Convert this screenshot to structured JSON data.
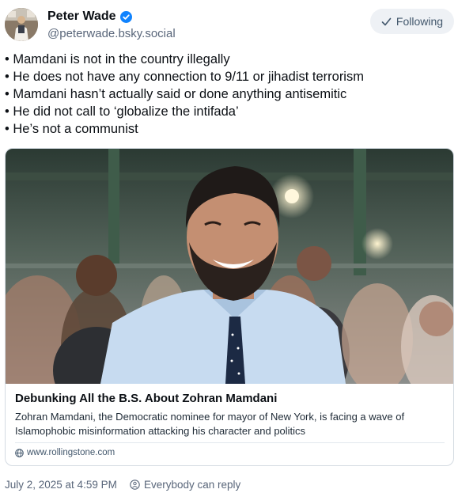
{
  "author": {
    "display_name": "Peter Wade",
    "handle": "@peterwade.bsky.social",
    "verified": true,
    "avatar_icon": "avatar-photo"
  },
  "follow_button": {
    "label": "Following",
    "icon": "check-icon"
  },
  "post": {
    "bullets": [
      "• Mamdani is not in the country illegally",
      "• He does not have any connection to 9/11 or jihadist terrorism",
      "• Mamdani hasn’t actually said or done anything antisemitic",
      "• He did not call to ‘globalize the intifada’",
      "• He’s not a communist"
    ]
  },
  "link_card": {
    "title": "Debunking All the B.S. About Zohran Mamdani",
    "description": "Zohran Mamdani, the Democratic nominee for mayor of New York, is facing a wave of Islamophobic misinformation attacking his character and politics",
    "domain": "www.rollingstone.com",
    "domain_icon": "globe-icon"
  },
  "footer": {
    "timestamp": "July 2, 2025 at 4:59 PM",
    "reply_setting": "Everybody can reply",
    "reply_icon": "reply-settings-icon"
  },
  "colors": {
    "accent": "#1083fe",
    "muted_text": "#59667a",
    "button_bg": "#eef1f5",
    "border": "#d4dbe2"
  }
}
